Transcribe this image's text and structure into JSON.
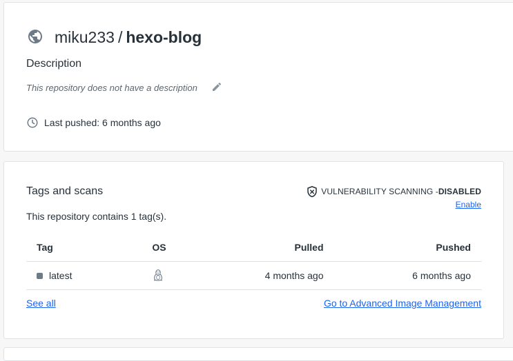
{
  "repo": {
    "namespace": "miku233",
    "separator": "/",
    "name": "hexo-blog",
    "icon": "globe-icon"
  },
  "description": {
    "heading": "Description",
    "text": "This repository does not have a description",
    "edit_icon": "pencil-icon"
  },
  "last_pushed": {
    "icon": "clock-icon",
    "text": "Last pushed: 6 months ago"
  },
  "tags_section": {
    "heading": "Tags and scans",
    "vulnerability": {
      "icon": "shield-x-icon",
      "label": "VULNERABILITY SCANNING - ",
      "status": "DISABLED",
      "enable_link": "Enable"
    },
    "count_text": "This repository contains 1 tag(s).",
    "columns": [
      "Tag",
      "OS",
      "Pulled",
      "Pushed"
    ],
    "rows": [
      {
        "tag": "latest",
        "os_icon": "linux-tux-icon",
        "pulled": "4 months ago",
        "pushed": "6 months ago"
      }
    ],
    "see_all": "See all",
    "advanced_link": "Go to Advanced Image Management"
  },
  "colors": {
    "link": "#1d63ed",
    "text": "#27313a",
    "muted": "#5b6670",
    "border": "#dfe3e6"
  }
}
